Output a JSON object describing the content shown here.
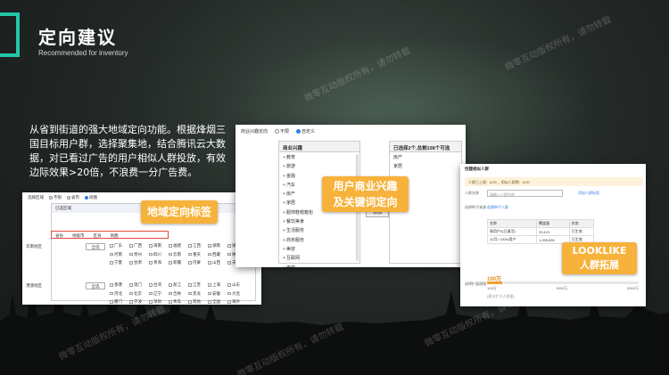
{
  "slide": {
    "title": "定向建议",
    "subtitle": "Recommended for inventory",
    "description": "从省到街道的强大地域定向功能。根据烽烟三国目标用户群，选择聚集地，结合腾讯云大数据，对已看过广告的用户相似人群投放，有效边际效果>20倍，不浪费一分广告费。"
  },
  "colors": {
    "accent": "#25c7a8",
    "callout": "#f6b23a",
    "link": "#2f7de1",
    "highlight_border": "#e04a3b"
  },
  "callouts": {
    "region": "地域定向标签",
    "interest_line1": "用户商业兴趣",
    "interest_line2": "及关键词定向",
    "lookalike_line1": "LOOKLIKE",
    "lookalike_line2": "人群拓展"
  },
  "region_panel": {
    "label": "选择区域",
    "options": [
      "不限",
      "省市",
      "商圈"
    ],
    "selected_header": "已选区域",
    "placeholder": "无选择",
    "tabs": [
      "省份",
      "地级市",
      "区县",
      "商圈"
    ],
    "groups": [
      {
        "name": "华南地区",
        "all": "全选",
        "items": [
          "广东",
          "广西",
          "海南",
          "福建",
          "江西",
          "湖南",
          "湖北",
          "河南",
          "贵州",
          "四川",
          "云南",
          "重庆",
          "西藏",
          "陕西",
          "宁夏",
          "甘肃",
          "青海",
          "新疆",
          "内蒙",
          "山西",
          "天津"
        ]
      },
      {
        "name": "港澳地区",
        "all": "全选",
        "items": [
          "香港",
          "澳门",
          "台湾",
          "浙江",
          "江苏",
          "上海",
          "山东",
          "河北",
          "北京",
          "辽宁",
          "吉林",
          "黑龙",
          "安徽",
          "大连",
          "厦门",
          "宁波",
          "深圳",
          "青岛",
          "其他",
          "全国",
          "海外"
        ]
      }
    ]
  },
  "interest_panel": {
    "label": "商业兴趣定向",
    "options": [
      "不限",
      "自定义"
    ],
    "list_header": "商业兴趣",
    "categories": [
      "教育",
      "旅游",
      "金融",
      "汽车",
      "房产",
      "家居",
      "服饰鞋帽箱包",
      "餐饮美食",
      "生活服务",
      "商务服务",
      "美容",
      "互联网",
      "电商"
    ],
    "add_button": "添加",
    "selected_header": "已选择2个,总剩198个可选",
    "selected": [
      "房产",
      "家居"
    ]
  },
  "lookalike_panel": {
    "title": "创建相似人群",
    "warning": "人群已上限：6/30 ，相似人群数：6/30",
    "name_label": "人群名称",
    "name_placeholder": "请输入人群名称",
    "name_link": "添加人群标签",
    "seed_label": "选择种子来源",
    "seed_link": "创建种子人群",
    "table_head": [
      "名称",
      "覆盖量",
      "状态"
    ],
    "table_rows": [
      [
        "和用户2(已激活)",
        "29,121",
        "已生效"
      ],
      [
        "12月 / 102w用户",
        "1,209,891",
        "已生效"
      ]
    ],
    "scale_label": "选择扩展规模",
    "scale_value": "100万",
    "scale_fraction": 0.1,
    "scale_ticks": [
      "100万",
      "3000万",
      "5000万"
    ],
    "note": "(建议扩大人群量)"
  },
  "watermark": "微零互动版权所有，请勿转载"
}
